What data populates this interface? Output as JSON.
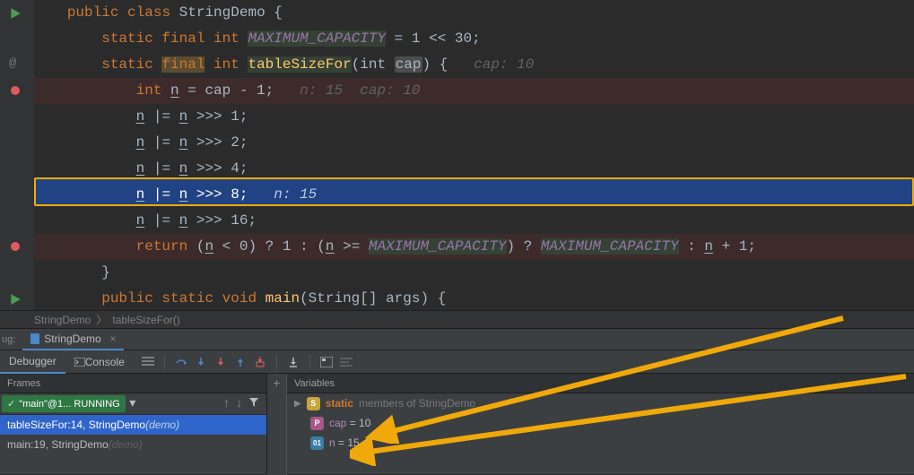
{
  "code": {
    "line1_public": "public",
    "line1_class": "class",
    "line1_name": " StringDemo {",
    "line2_mods": "static final int",
    "line2_const": "MAXIMUM_CAPACITY",
    "line2_rest": " = 1 << 30;",
    "line3_static": "static ",
    "line3_final": "final",
    "line3_int": " int ",
    "line3_method": "tableSizeFor",
    "line3_paren_int": "(int ",
    "line3_cap": "cap",
    "line3_close": ") {   ",
    "line3_hint": "cap: 10",
    "line4_int": "int ",
    "line4_n": "n",
    "line4_mid": " = cap - 1;   ",
    "line4_hint": "n: 15  cap: 10",
    "line5_n1": "n",
    "line5_mid": " |= ",
    "line5_n2": "n",
    "line5_end": " >>> 1;",
    "line6_shift": " >>> 2;",
    "line7_shift": " >>> 4;",
    "line8_shift": " >>> 8;   ",
    "line8_hint": "n: 15",
    "line9_shift": " >>> 16;",
    "line10_return": "return",
    "line10_p1": " (",
    "line10_n": "n",
    "line10_cond1": " < 0) ? 1 : (",
    "line10_n2": "n",
    "line10_cond2": " >= ",
    "line10_mc1": "MAXIMUM_CAPACITY",
    "line10_cond3": ") ? ",
    "line10_mc2": "MAXIMUM_CAPACITY",
    "line10_cond4": " : ",
    "line10_n3": "n",
    "line10_end": " + 1;",
    "line11": "}",
    "line12_mods": "public static void",
    "line12_main": " main",
    "line12_args": "(String[] args) {"
  },
  "breadcrumb": {
    "class": "StringDemo",
    "method": "tableSizeFor()"
  },
  "tabs": {
    "side_label": "ug:",
    "tab1": " StringDemo"
  },
  "toolbar": {
    "debugger": "Debugger",
    "console": " Console"
  },
  "frames": {
    "header": "Frames",
    "thread": "\"main\"@1... RUNNING",
    "f1": "tableSizeFor:14, StringDemo ",
    "f1_demo": "(demo)",
    "f2": "main:19, StringDemo ",
    "f2_demo": "(demo)"
  },
  "vars": {
    "header": "Variables",
    "static_label": "static",
    "static_members": " members of StringDemo",
    "cap_name": "cap",
    "cap_eq": " = ",
    "cap_val": "10",
    "n_name": "n",
    "n_eq": " = ",
    "n_val": "15"
  }
}
